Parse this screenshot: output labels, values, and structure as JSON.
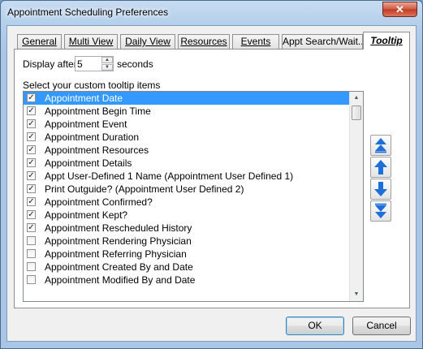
{
  "window": {
    "title": "Appointment Scheduling Preferences",
    "close_glyph": "✕"
  },
  "tabs": [
    {
      "label": "General",
      "active": false
    },
    {
      "label": "Multi View",
      "active": false
    },
    {
      "label": "Daily View",
      "active": false
    },
    {
      "label": "Resources",
      "active": false
    },
    {
      "label": "Events",
      "active": false
    },
    {
      "label": "Appt  Search/Wait...",
      "active": false
    },
    {
      "label": "Tooltip",
      "active": true
    }
  ],
  "tooltip": {
    "display_after_label": "Display after",
    "display_after_value": "5",
    "seconds_label": "seconds",
    "list_label": "Select your custom tooltip items",
    "items": [
      {
        "label": "Appointment Date",
        "checked": true,
        "selected": true
      },
      {
        "label": "Appointment Begin Time",
        "checked": true,
        "selected": false
      },
      {
        "label": "Appointment Event",
        "checked": true,
        "selected": false
      },
      {
        "label": "Appointment Duration",
        "checked": true,
        "selected": false
      },
      {
        "label": "Appointment Resources",
        "checked": true,
        "selected": false
      },
      {
        "label": "Appointment Details",
        "checked": true,
        "selected": false
      },
      {
        "label": "Appt User-Defined 1 Name (Appointment User Defined 1)",
        "checked": true,
        "selected": false
      },
      {
        "label": "Print Outguide? (Appointment User Defined 2)",
        "checked": true,
        "selected": false
      },
      {
        "label": "Appointment Confirmed?",
        "checked": true,
        "selected": false
      },
      {
        "label": "Appointment Kept?",
        "checked": true,
        "selected": false
      },
      {
        "label": "Appointment Rescheduled History",
        "checked": true,
        "selected": false
      },
      {
        "label": "Appointment Rendering Physician",
        "checked": false,
        "selected": false
      },
      {
        "label": "Appointment Referring Physician",
        "checked": false,
        "selected": false
      },
      {
        "label": "Appointment Created By and Date",
        "checked": false,
        "selected": false
      },
      {
        "label": "Appointment Modified By and Date",
        "checked": false,
        "selected": false
      }
    ],
    "move_buttons": [
      "move-top-icon",
      "move-up-icon",
      "move-down-icon",
      "move-bottom-icon"
    ]
  },
  "buttons": {
    "ok": "OK",
    "cancel": "Cancel"
  },
  "colors": {
    "selection": "#3399ff",
    "arrow_blue": "#1e6fd9"
  }
}
